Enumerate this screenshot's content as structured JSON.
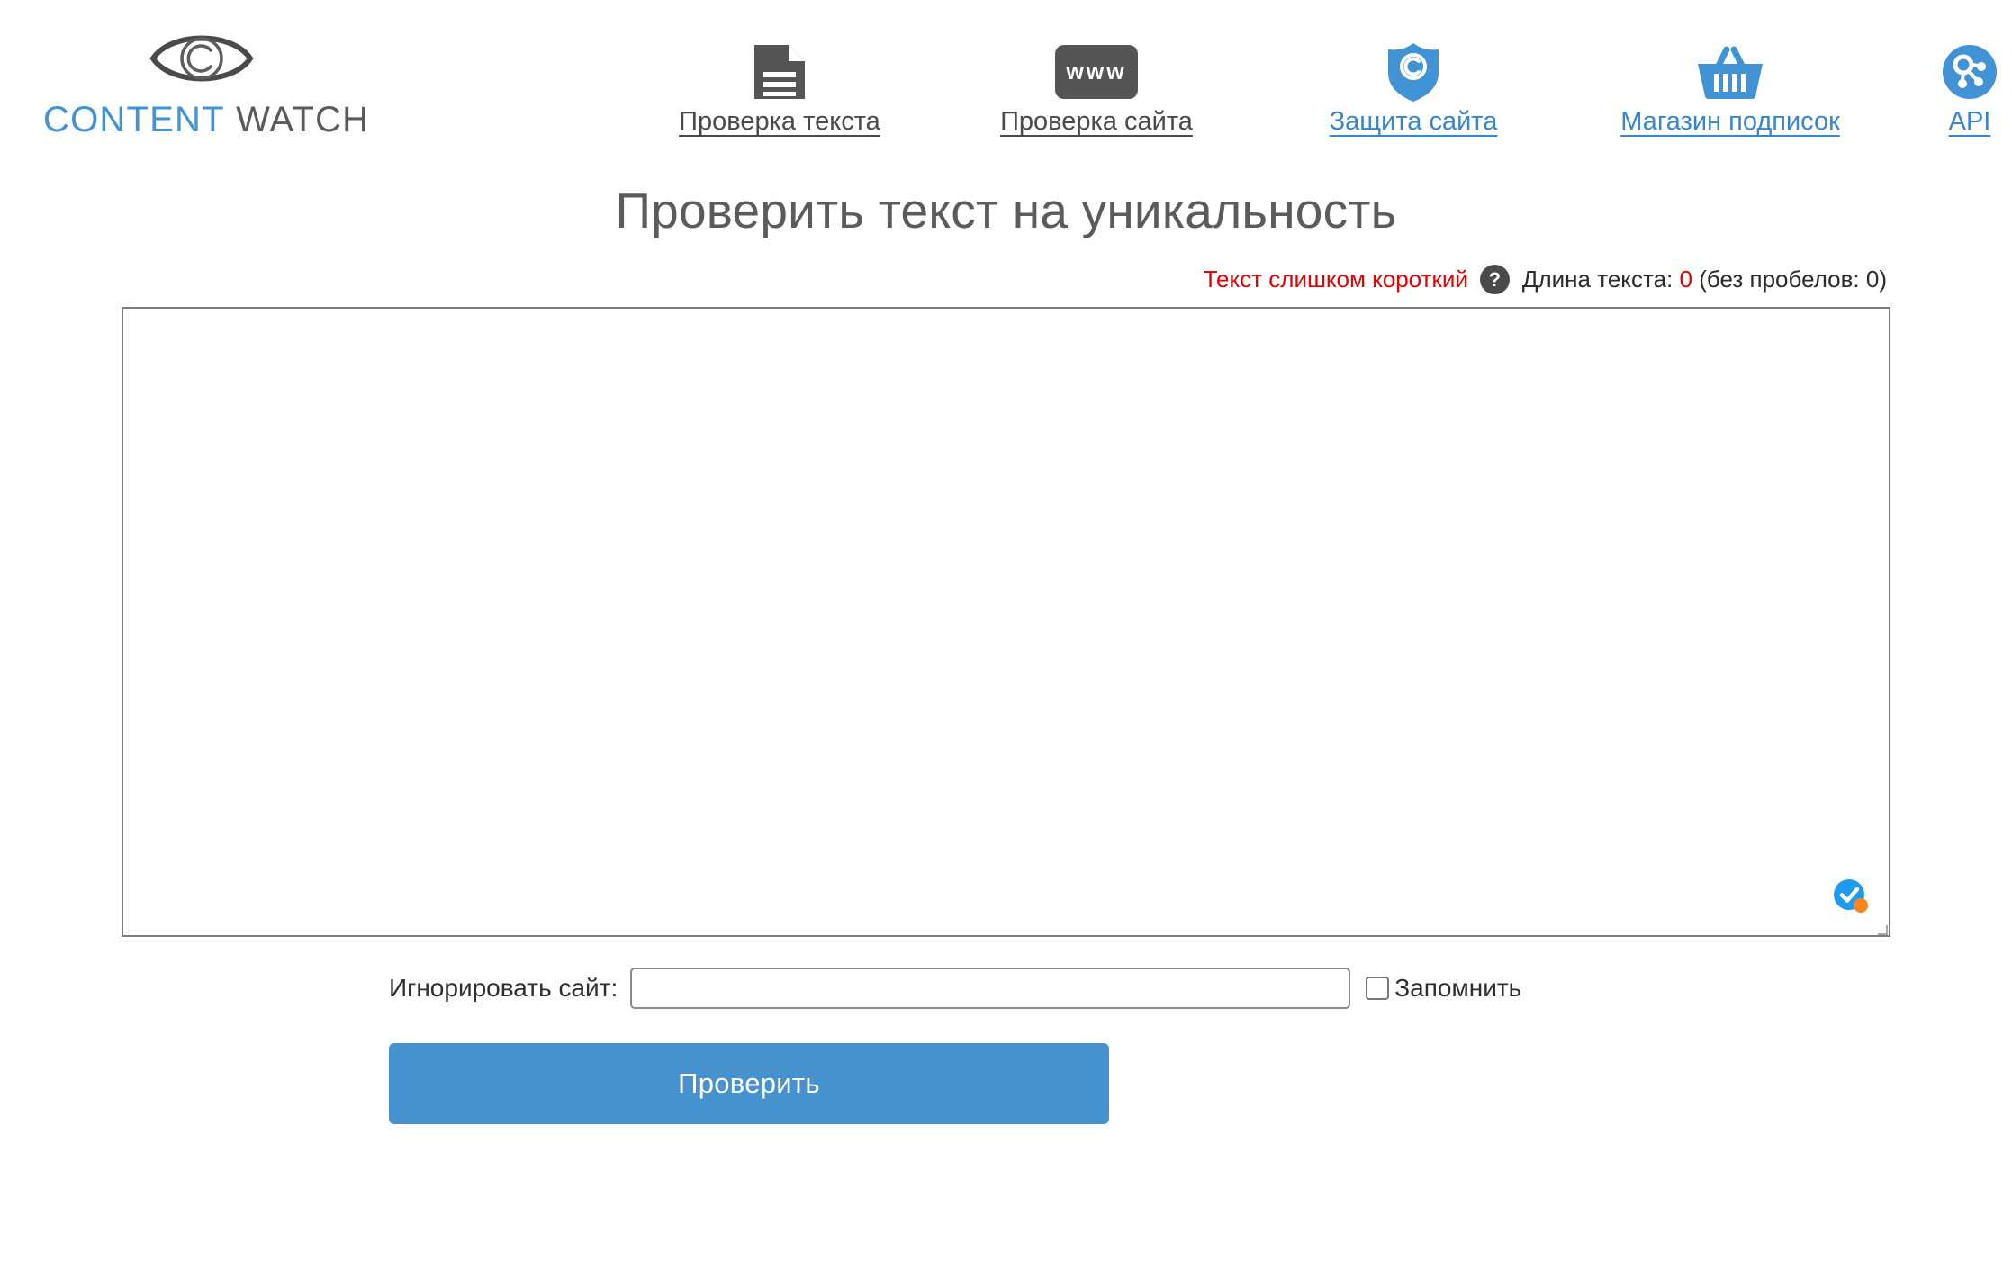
{
  "brand": {
    "name_part1": "CONTENT",
    "name_part2": "WATCH",
    "logo_icon": "eye-copyright-icon",
    "blue": "#4292d6",
    "gray": "#5a5a5a"
  },
  "nav": {
    "items": [
      {
        "label": "Проверка текста",
        "icon": "document-icon",
        "style": "dark"
      },
      {
        "label": "Проверка сайта",
        "icon": "www-icon",
        "style": "dark"
      },
      {
        "label": "Защита сайта",
        "icon": "shield-copyright-icon",
        "style": "blue"
      },
      {
        "label": "Магазин подписок",
        "icon": "shopping-basket-icon",
        "style": "blue"
      },
      {
        "label": "API",
        "icon": "api-network-icon",
        "style": "blue"
      }
    ],
    "www_text": "www"
  },
  "main": {
    "title": "Проверить текст на уникальность",
    "status": {
      "warning": "Текст слишком короткий",
      "help_icon": "question-mark-icon",
      "help_glyph": "?",
      "length_prefix": "Длина текста:",
      "length_value": "0",
      "length_suffix": "(без пробелов: 0)",
      "warning_color": "#e80000"
    },
    "editor": {
      "value": "",
      "placeholder": "",
      "badge_icon": "check-circle-badge-icon",
      "resize_handle": "resize-grip"
    },
    "ignore": {
      "label": "Игнорировать сайт:",
      "value": "",
      "placeholder": "",
      "remember_label": "Запомнить",
      "remember_checked": false
    },
    "submit_label": "Проверить",
    "submit_color": "#4692ce"
  }
}
